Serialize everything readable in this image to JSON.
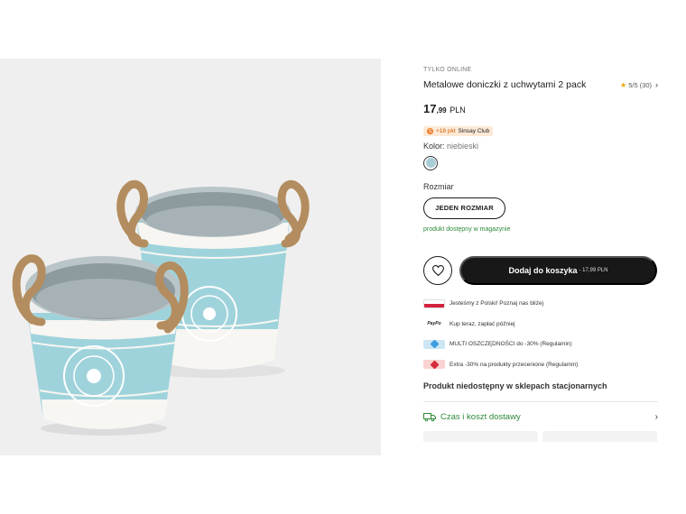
{
  "product": {
    "kicker": "TYLKO ONLINE",
    "title": "Metalowe doniczki z uchwytami 2 pack",
    "rating": {
      "score": "5/5",
      "count": "(30)",
      "stars": 5
    },
    "price": {
      "integer": "17",
      "decimal": ",99",
      "currency": "PLN"
    },
    "club": {
      "points": "+18 pkt",
      "name": "Sinsay Club"
    },
    "color": {
      "label": "Kolor:",
      "value": "niebieski",
      "hex": "#a9cdd4"
    },
    "size": {
      "label": "Rozmiar",
      "option": "JEDEN ROZMIAR"
    },
    "stock": "produkt dostępny w magazynie"
  },
  "cta": {
    "favorite_icon": "heart-icon",
    "add_label": "Dodaj do koszyka",
    "add_price": "- 17,99 PLN"
  },
  "perks": [
    {
      "icon": "poland-flag-icon",
      "text": "Jesteśmy z Polski! Poznaj nas bliżej"
    },
    {
      "icon": "paypo-logo-icon",
      "logo": "PayPo",
      "text": "Kup teraz, zapłać później"
    },
    {
      "icon": "blue-tag-icon",
      "text": "MULTI OSZCZĘDNOŚCI do -30% (Regulamin)"
    },
    {
      "icon": "red-tag-icon",
      "text": "Extra -30% na produkty przecenione (Regulamin)"
    }
  ],
  "store_availability": "Produkt niedostępny w sklepach stacjonarnych",
  "delivery": {
    "label": "Czas i koszt dostawy",
    "icon": "truck-icon"
  },
  "colors": {
    "accent_green": "#2e8a3a",
    "button_dark": "#181818",
    "pot_blue": "#9fd3dc"
  }
}
